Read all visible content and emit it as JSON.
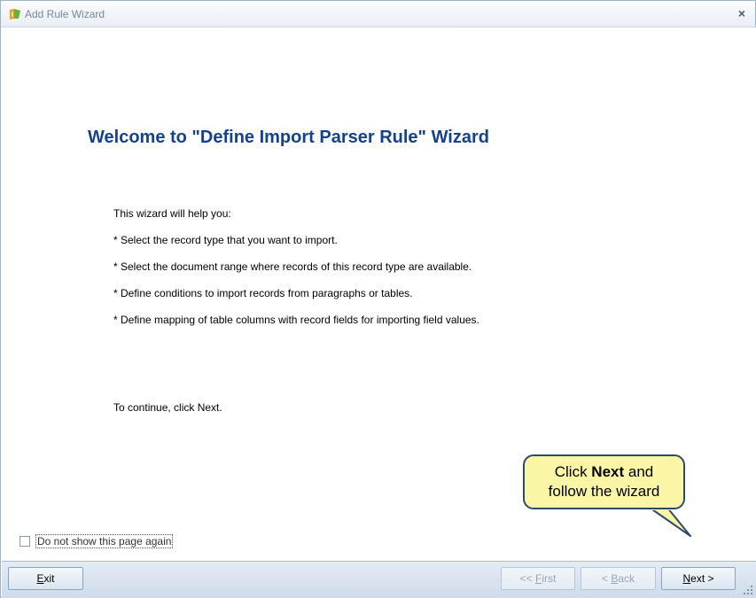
{
  "window": {
    "title": "Add Rule Wizard",
    "close_glyph": "×"
  },
  "main": {
    "heading": "Welcome to \"Define Import Parser Rule\" Wizard",
    "intro": "This wizard will help you:",
    "bullets": [
      "* Select the record type that you want to import.",
      "* Select the document range where records of this record type are available.",
      "* Define conditions to import records from paragraphs or tables.",
      "* Define mapping of table columns with record fields for importing field values."
    ],
    "continue_text": "To continue, click Next.",
    "dont_show_label": "Do not show this page again",
    "dont_show_checked": false
  },
  "callout": {
    "line1_prefix": "Click ",
    "line1_bold": "Next",
    "line1_suffix": " and",
    "line2": "follow the wizard"
  },
  "footer": {
    "exit": {
      "mnemonic": "E",
      "rest": "xit"
    },
    "first": {
      "prefix": "<< ",
      "mnemonic": "F",
      "rest": "irst"
    },
    "back": {
      "prefix": "< ",
      "mnemonic": "B",
      "rest": "ack"
    },
    "next": {
      "mnemonic": "N",
      "rest": "ext >"
    }
  },
  "colors": {
    "heading": "#15428b",
    "callout_fill": "#fbf5a6",
    "callout_border": "#2c4a6b"
  }
}
